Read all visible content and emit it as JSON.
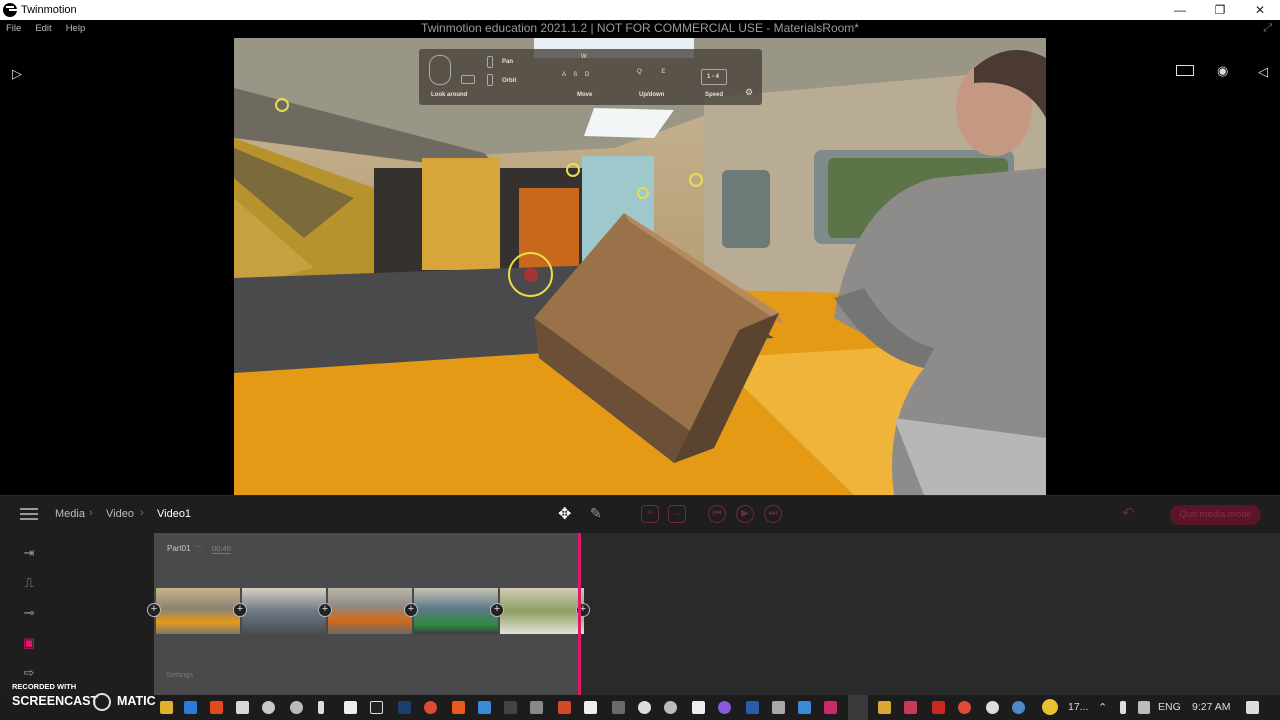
{
  "window": {
    "app_name": "Twinmotion",
    "doc_title": "Twinmotion education 2021.1.2 | NOT FOR COMMERCIAL USE - MaterialsRoom*",
    "controls": [
      "—",
      "❐",
      "✕"
    ]
  },
  "menu": [
    "File",
    "Edit",
    "Help"
  ],
  "nav_hud": {
    "look_around": "Look around",
    "pan": "Pan",
    "orbit": "Orbit",
    "move": "Move",
    "up_down": "Up/down",
    "speed": "Speed",
    "speed_keys": "1 - 4",
    "move_keys_top": "W",
    "move_keys": "A S D",
    "updown_keys": "Q E"
  },
  "toolbar": {
    "breadcrumb": [
      "Media",
      "Video",
      "Video1"
    ],
    "exit_label": "Quit media mode"
  },
  "timeline": {
    "part_label": "Part01",
    "part_time": "00:40",
    "settings_label": "Settings"
  },
  "taskbar": {
    "weather_temp": "17...",
    "language": "ENG",
    "time": "9:27 AM"
  },
  "watermark": {
    "line1": "RECORDED WITH",
    "line2a": "SCREENCAST",
    "line2b": "MATIC"
  },
  "colors": {
    "accent_pink": "#e0176a",
    "floor_orange": "#e59a16",
    "panel_bg": "#1e1e1f"
  }
}
